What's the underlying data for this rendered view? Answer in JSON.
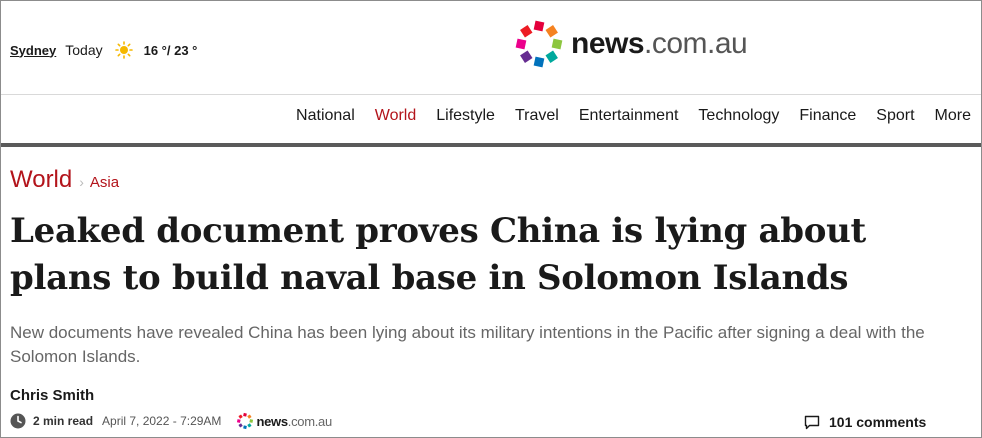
{
  "header": {
    "weather": {
      "city": "Sydney",
      "day": "Today",
      "icon": "sun-icon",
      "temperature": "16 °/ 23 °"
    },
    "logo": {
      "name": "news",
      "domain": ".com.au",
      "dot_colors": [
        "#e4003b",
        "#f58220",
        "#8dc63f",
        "#00a99d",
        "#0072bc",
        "#662d91",
        "#ec008c",
        "#ed1c24"
      ]
    }
  },
  "nav": {
    "items": [
      "National",
      "World",
      "Lifestyle",
      "Travel",
      "Entertainment",
      "Technology",
      "Finance",
      "Sport",
      "More"
    ],
    "active": "World",
    "accent_color": "#b3141b"
  },
  "article": {
    "breadcrumb": {
      "section": "World",
      "subsection": "Asia",
      "separator": "›"
    },
    "headline": "Leaked document proves China is lying about plans to build naval base in Solomon Islands",
    "standfirst": "New documents have revealed China has been lying about its military intentions in the Pacific after signing a deal with the Solomon Islands.",
    "author": "Chris Smith",
    "meta": {
      "read_time": "2 min read",
      "published": "April 7, 2022 - 7:29AM",
      "source_name": "news",
      "source_domain": ".com.au"
    },
    "comments": {
      "icon": "comment-icon",
      "label": "101 comments"
    }
  }
}
